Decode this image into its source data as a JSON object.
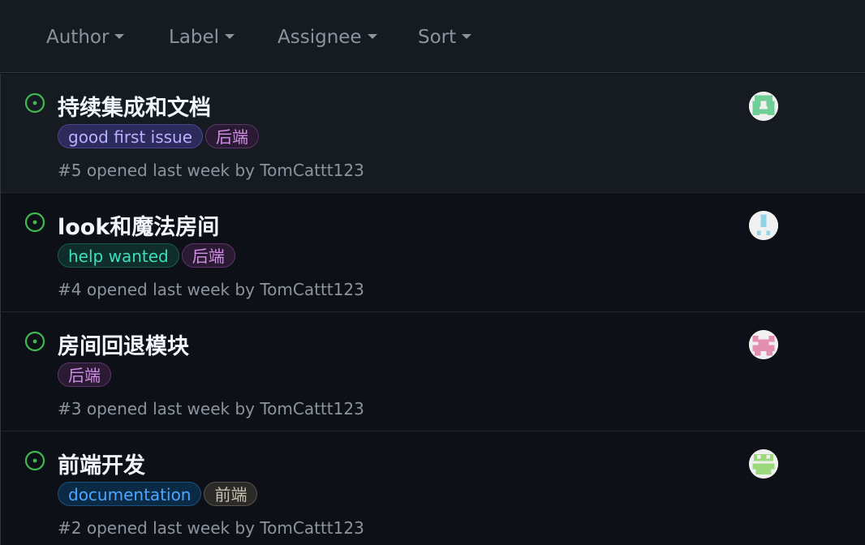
{
  "filters": {
    "author": "Author",
    "label": "Label",
    "assignee": "Assignee",
    "sort": "Sort"
  },
  "colors": {
    "open_icon": "#3fb950",
    "label_good_first_issue": {
      "bg": "#2d2a5c",
      "border": "#4b4490",
      "text": "#b8b1ff"
    },
    "label_backend": {
      "bg": "#2b1a33",
      "border": "#5b3569",
      "text": "#d28fe8"
    },
    "label_help_wanted": {
      "bg": "#0f2d2a",
      "border": "#1c5a51",
      "text": "#3ae0bc"
    },
    "label_documentation": {
      "bg": "#0b2a45",
      "border": "#1c4f7c",
      "text": "#4aa6ff"
    },
    "label_frontend": {
      "bg": "#2b2a27",
      "border": "#57544d",
      "text": "#c9c2b4"
    }
  },
  "issues": [
    {
      "title": "持续集成和文档",
      "labels": [
        "good first issue",
        "后端"
      ],
      "number": "#5",
      "opened": "opened last week by",
      "author": "TomCattt123",
      "avatar_icon": "identicon-green"
    },
    {
      "title": "look和魔法房间",
      "labels": [
        "help wanted",
        "后端"
      ],
      "number": "#4",
      "opened": "opened last week by",
      "author": "TomCattt123",
      "avatar_icon": "identicon-lightblue"
    },
    {
      "title": "房间回退模块",
      "labels": [
        "后端"
      ],
      "number": "#3",
      "opened": "opened last week by",
      "author": "TomCattt123",
      "avatar_icon": "identicon-pink"
    },
    {
      "title": "前端开发",
      "labels": [
        "documentation",
        "前端"
      ],
      "number": "#2",
      "opened": "opened last week by",
      "author": "TomCattt123",
      "avatar_icon": "identicon-lightgreen"
    }
  ]
}
